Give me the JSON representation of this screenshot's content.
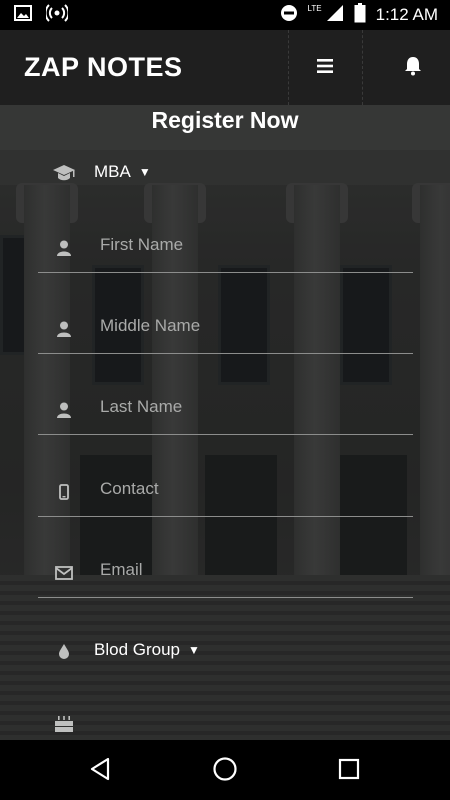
{
  "status_bar": {
    "time": "1:12 AM",
    "network": "LTE",
    "icons": [
      "gallery-icon",
      "hotspot-icon",
      "dnd-icon",
      "signal-icon",
      "battery-icon"
    ]
  },
  "app_bar": {
    "title": "ZAP NOTES",
    "icons": [
      "menu-icon",
      "bell-icon"
    ]
  },
  "form": {
    "heading": "Register Now",
    "course": {
      "selected": "MBA",
      "icon": "graduation-cap-icon"
    },
    "fields": [
      {
        "placeholder": "First Name",
        "icon": "user-icon"
      },
      {
        "placeholder": "Middle Name",
        "icon": "user-icon"
      },
      {
        "placeholder": "Last Name",
        "icon": "user-icon"
      },
      {
        "placeholder": "Contact",
        "icon": "mobile-icon"
      },
      {
        "placeholder": "Email",
        "icon": "envelope-icon"
      }
    ],
    "blood_group": {
      "selected": "Blod Group",
      "icon": "drop-icon"
    },
    "birthday": {
      "icon": "birthday-cake-icon"
    }
  },
  "nav_bar": {
    "icons": [
      "back-icon",
      "home-icon",
      "recents-icon"
    ]
  },
  "colors": {
    "app_bar": "#1f1f1f",
    "placeholder": "#a9aaa9",
    "underline": "#8c8d8c"
  }
}
